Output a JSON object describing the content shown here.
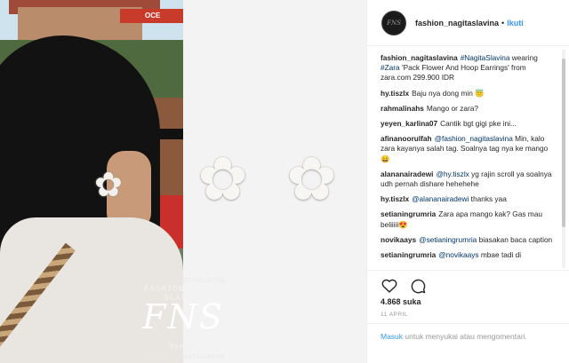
{
  "photo": {
    "sign_text": "OCE",
    "watermark": {
      "handle_top": "@FASHION_NAGITASLAVINA",
      "name": "FASHION NAGITA SLAVINA",
      "logo": "FNS",
      "family": "FAMILY",
      "handle_bottom": "@FASHION_NAGITASLAVINA"
    },
    "earring_icon": "flower-earring-icon"
  },
  "header": {
    "username": "fashion_nagitaslavina",
    "separator": "•",
    "follow_label": "Ikuti"
  },
  "caption": {
    "username": "fashion_nagitaslavina",
    "tag1": "#NagitaSlavina",
    "text1": " wearing ",
    "tag2": "#Zara",
    "text2": " 'Pack Flower And Hoop Earrings' from zara.com 299.900 IDR"
  },
  "comments": [
    {
      "username": "hy.tiszlx",
      "mention": "",
      "text": "Baju nya dong min 😇"
    },
    {
      "username": "rahmalinahs",
      "mention": "",
      "text": "Mango or zara?"
    },
    {
      "username": "yeyen_karlina07",
      "mention": "",
      "text": "Cantik bgt gigi pke ini..."
    },
    {
      "username": "afinanoorulfah",
      "mention": "@fashion_nagitaslavina",
      "text": " Min, kalo zara kayanya salah tag. Soalnya tag nya ke mango😄"
    },
    {
      "username": "alananairadewi",
      "mention": "@hy.tiszlx",
      "text": " yg rajin scroll ya soalnya udh pernah dishare hehehehe"
    },
    {
      "username": "hy.tiszlx",
      "mention": "@alananairadewi",
      "text": " thanks yaa"
    },
    {
      "username": "setianingrumria",
      "mention": "",
      "text": "Zara apa mango kak? Gas mau beliiiii😍"
    },
    {
      "username": "novikaays",
      "mention": "@setianingrumria",
      "text": " biasakan baca caption"
    },
    {
      "username": "setianingrumria",
      "mention": "@novikaays",
      "text": " mbae tadi di"
    }
  ],
  "actions": {
    "like_icon": "heart-icon",
    "comment_icon": "comment-icon"
  },
  "likes": "4.868 suka",
  "date": "11 APRIL",
  "login": {
    "link": "Masuk",
    "text": " untuk menyukai atau mengomentari."
  }
}
